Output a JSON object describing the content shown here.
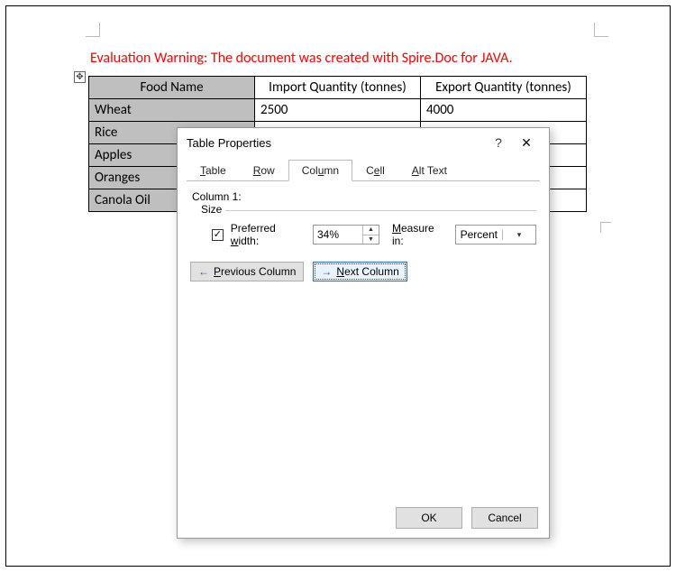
{
  "document": {
    "evaluation_warning": "Evaluation Warning: The document was created with Spire.Doc for JAVA.",
    "table": {
      "headers": [
        "Food Name",
        "Import Quantity (tonnes)",
        "Export Quantity (tonnes)"
      ],
      "rows": [
        [
          "Wheat",
          "2500",
          "4000"
        ],
        [
          "Rice",
          "",
          ""
        ],
        [
          "Apples",
          "",
          ""
        ],
        [
          "Oranges",
          "",
          ""
        ],
        [
          "Canola Oil",
          "",
          ""
        ]
      ]
    }
  },
  "dialog": {
    "title": "Table Properties",
    "tabs": {
      "table": "Table",
      "row": "Row",
      "column": "Column",
      "cell": "Cell",
      "alt_text": "Alt Text",
      "active": "Column"
    },
    "column_pane": {
      "heading": "Column 1:",
      "size_legend": "Size",
      "preferred_width_label": "Preferred width:",
      "preferred_width_checked": true,
      "width_value": "34%",
      "measure_label": "Measure in:",
      "measure_value": "Percent",
      "prev_label": "Previous Column",
      "next_label": "Next Column"
    },
    "footer": {
      "ok": "OK",
      "cancel": "Cancel"
    }
  }
}
